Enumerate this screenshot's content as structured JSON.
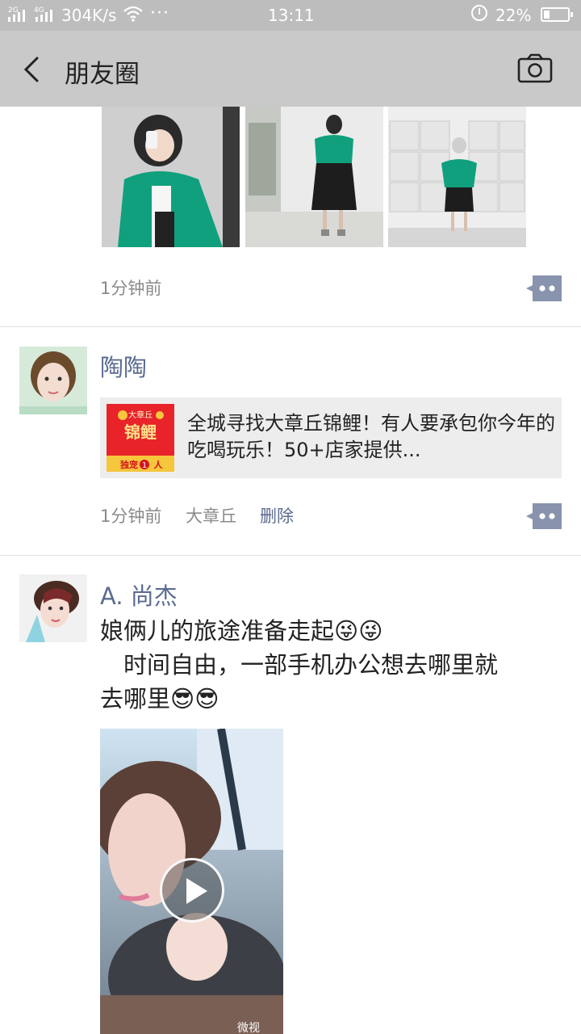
{
  "status_bar": {
    "sig1": "2G",
    "sig2": "4G",
    "speed": "304K/s",
    "dots": "···",
    "time": "13:11",
    "battery": "22%"
  },
  "nav": {
    "title": "朋友圈",
    "back_icon": "chevron-left-icon",
    "camera_icon": "camera-icon"
  },
  "posts": [
    {
      "time": "1分钟前",
      "photos": [
        "photo-selfie-green-cardigan",
        "photo-full-body-green-cardigan",
        "photo-lockers-green-cardigan"
      ]
    },
    {
      "name": "陶陶",
      "share": {
        "thumb_line1": "大章丘",
        "thumb_line2": "锦鲤",
        "thumb_line3": "独宠",
        "thumb_num": "1",
        "thumb_line4": "人",
        "title": "全城寻找大章丘锦鲤！有人要承包你今年的吃喝玩乐！50+店家提供..."
      },
      "time": "1分钟前",
      "location": "大章丘",
      "delete": "删除"
    },
    {
      "name": "A. 尚杰",
      "text_line1": "娘俩儿的旅途准备走起",
      "text_line2": "　时间自由，一部手机办公想去哪里就",
      "text_line3": "去哪里",
      "emoji_wink": "😜",
      "emoji_cool": "😎",
      "video_label": "微视"
    }
  ],
  "colors": {
    "link": "#5b6a91",
    "nav_bg": "#c9c9c9",
    "status_bg": "#bdbdbd",
    "share_bg": "#ededed"
  }
}
